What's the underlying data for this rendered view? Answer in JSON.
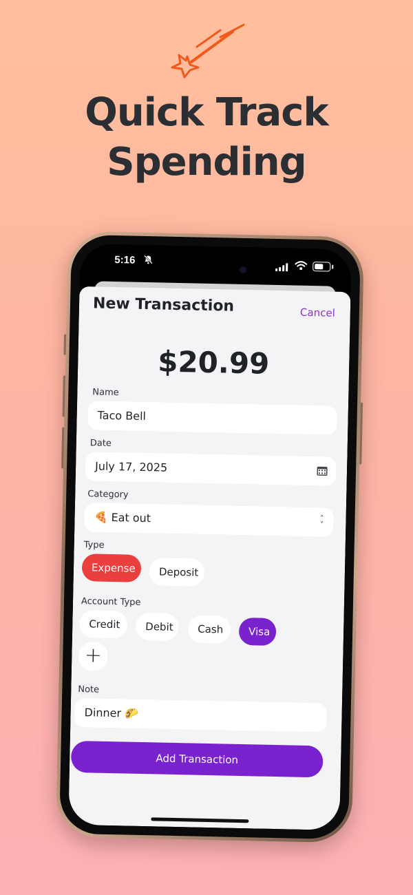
{
  "headline": {
    "line1": "Quick Track",
    "line2": "Spending"
  },
  "status": {
    "time": "5:16"
  },
  "sheet": {
    "title": "New Transaction",
    "cancel": "Cancel",
    "amount": "$20.99",
    "name_label": "Name",
    "name_value": "Taco Bell",
    "date_label": "Date",
    "date_value": "July 17, 2025",
    "category_label": "Category",
    "category_value": "🍕 Eat out",
    "type_label": "Type",
    "type_options": [
      "Expense",
      "Deposit"
    ],
    "type_selected": "Expense",
    "account_label": "Account Type",
    "account_options": [
      "Credit",
      "Debit",
      "Cash",
      "Visa"
    ],
    "account_selected": "Visa",
    "add_symbol": "+",
    "note_label": "Note",
    "note_value": "Dinner 🌮",
    "submit": "Add Transaction"
  },
  "colors": {
    "accent": "#7b22cf",
    "expense": "#ea3f3f",
    "logo": "#f0591c",
    "headline": "#2b2f33"
  }
}
